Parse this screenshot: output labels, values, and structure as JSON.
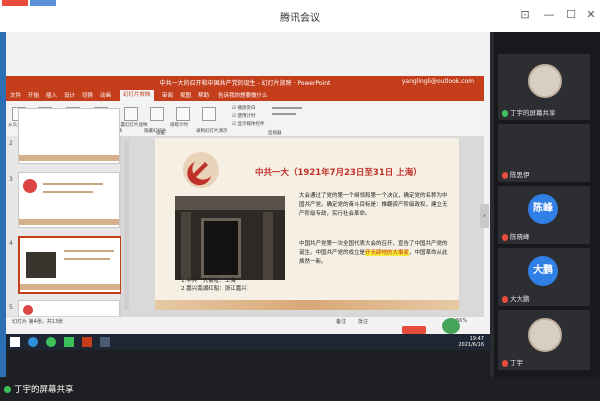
{
  "window": {
    "title": "腾讯会议",
    "controls": {
      "pin": "⊡",
      "minimize": "—",
      "maximize": "☐",
      "close": "✕"
    }
  },
  "powerpoint": {
    "title": "中共一大的召开和中国共产党的诞生 - 幻灯片放映 · PowerPoint",
    "user": "yanglingli@outlook.com",
    "tabs": [
      "文件",
      "开始",
      "插入",
      "设计",
      "切换",
      "动画",
      "幻灯片放映",
      "审阅",
      "视图",
      "帮助",
      "告诉我你想要做什么"
    ],
    "active_tab_index": 6,
    "ribbon": {
      "groups": [
        "从头开始",
        "从当前幻灯片开始",
        "联机演示",
        "自定义幻灯片放映",
        "设置幻灯片放映",
        "隐藏幻灯片",
        "排练计时",
        "录制幻灯片演示"
      ],
      "checkboxes": [
        "播放旁白",
        "使用计时",
        "显示媒体控件"
      ],
      "group_labels": [
        "开始放映幻灯片",
        "设置",
        "监视器"
      ]
    },
    "thumbnails": [
      {
        "num": "2"
      },
      {
        "num": "3"
      },
      {
        "num": "4"
      },
      {
        "num": "5"
      }
    ],
    "selected_thumbnail": 2,
    "status": {
      "left": "幻灯片 第4张，共13张",
      "notes": "备注",
      "comments": "批注",
      "zoom": "66%"
    }
  },
  "slide": {
    "heading": "中共一大（1921年7月23日至31日  上海）",
    "paragraph1": "大会通过了党的第一个纲领和第一个决议，确定党的名称为中国共产党。确定党的奋斗目标是：推翻资产阶级政权，建立无产阶级专政，实行社会革命。",
    "paragraph2_pre": "中国共产党第一次全国代表大会的召开，宣告了中国共产党的诞生。中国共产党的成立是",
    "paragraph2_highlight": "开天辟地的大事变",
    "paragraph2_post": "，中国革命从此焕然一新。",
    "caption1": "1.中共一大会址：上海",
    "caption2": "2.嘉兴南湖红船：浙江嘉兴"
  },
  "taskbar": {
    "time": "19:47",
    "date": "2021/6/16"
  },
  "participants": [
    {
      "name": "丁宇的屏幕共享",
      "avatar_text": "",
      "avatar_type": "image",
      "mic": "on"
    },
    {
      "name": "陈思伊",
      "avatar_text": "",
      "avatar_type": "none",
      "mic": "off"
    },
    {
      "name": "陈晓峰",
      "avatar_text": "陈峰",
      "avatar_type": "text",
      "mic": "off"
    },
    {
      "name": "大大鹏",
      "avatar_text": "大鹏",
      "avatar_type": "text",
      "mic": "off"
    },
    {
      "name": "丁宇",
      "avatar_text": "",
      "avatar_type": "image",
      "mic": "off"
    }
  ],
  "presenter_label": "丁宇的屏幕共享",
  "colors": {
    "ppt_red": "#c43e1c",
    "accent_blue": "#2f7fe6",
    "mic_on": "#3cc05a",
    "mic_off": "#e74c3c"
  }
}
